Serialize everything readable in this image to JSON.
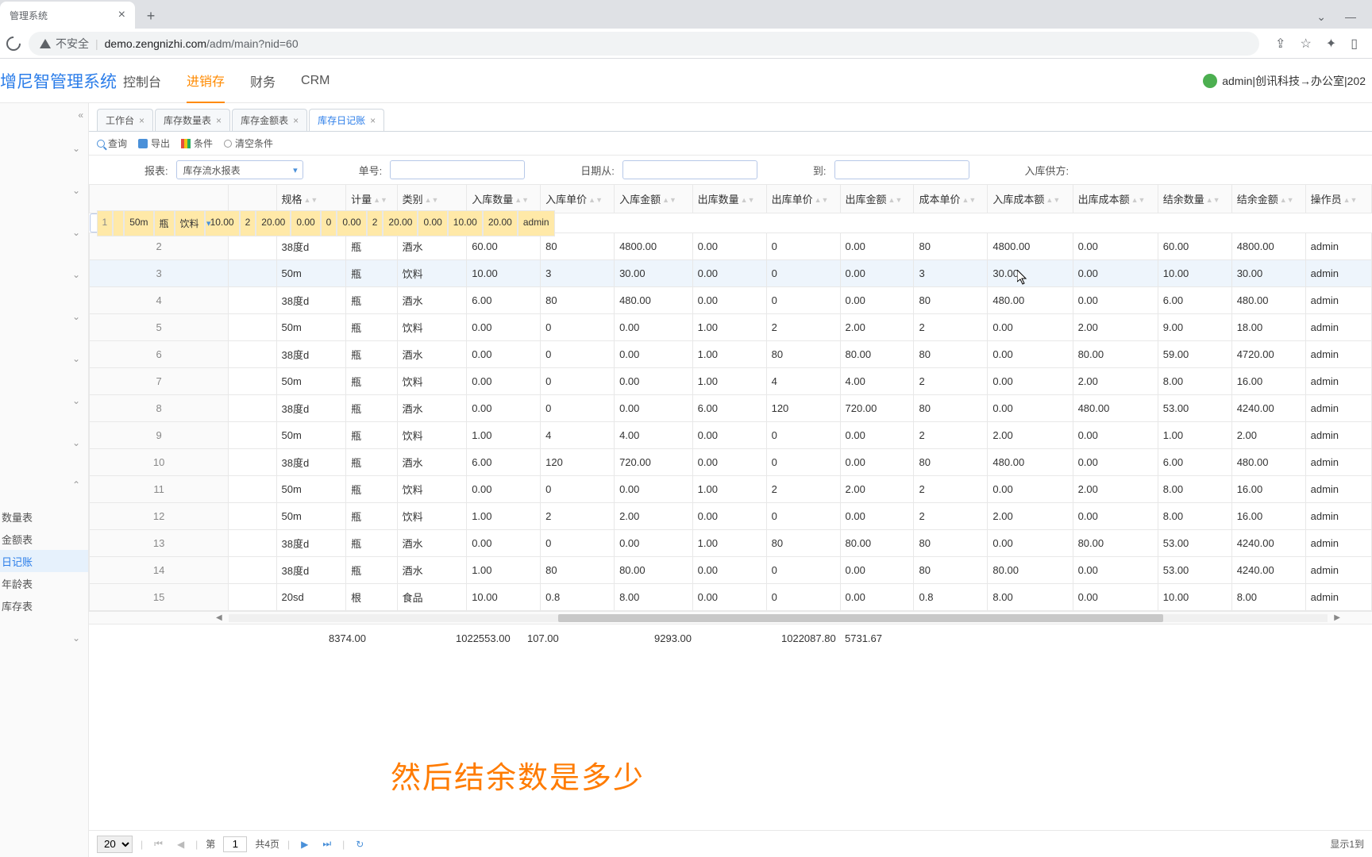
{
  "browser": {
    "tab_title": "管理系统",
    "insecure_label": "不安全",
    "url_host": "demo.zengnizhi.com",
    "url_path": "/adm/main?nid=60"
  },
  "header": {
    "logo": "增尼智管理系统",
    "nav": [
      "控制台",
      "进销存",
      "财务",
      "CRM"
    ],
    "nav_active_index": 1,
    "user": "admin|创讯科技→办公室|202"
  },
  "sidebar": {
    "leaves": [
      "数量表",
      "金额表",
      "日记账",
      "年龄表",
      "库存表"
    ],
    "active_leaf_index": 2
  },
  "tabs": {
    "items": [
      "工作台",
      "库存数量表",
      "库存金额表",
      "库存日记账"
    ],
    "active_index": 3
  },
  "toolbar": {
    "query": "查询",
    "export": "导出",
    "condition": "条件",
    "clear": "清空条件"
  },
  "filters": {
    "report_label": "报表:",
    "report_value": "库存流水报表",
    "bill_label": "单号:",
    "date_from_label": "日期从:",
    "date_to_label": "到:",
    "supplier_label": "入库供方:"
  },
  "columns": [
    "规格",
    "计量",
    "类别",
    "入库数量",
    "入库单价",
    "入库金额",
    "出库数量",
    "出库单价",
    "出库金额",
    "成本单价",
    "入库成本额",
    "出库成本额",
    "结余数量",
    "结余金额",
    "操作员"
  ],
  "rows": [
    {
      "n": 1,
      "sel": true,
      "c": [
        "50m",
        "瓶",
        "饮料",
        "10.00",
        "2",
        "20.00",
        "0.00",
        "0",
        "0.00",
        "2",
        "20.00",
        "0.00",
        "10.00",
        "20.00",
        "admin"
      ]
    },
    {
      "n": 2,
      "c": [
        "38度d",
        "瓶",
        "酒水",
        "60.00",
        "80",
        "4800.00",
        "0.00",
        "0",
        "0.00",
        "80",
        "4800.00",
        "0.00",
        "60.00",
        "4800.00",
        "admin"
      ]
    },
    {
      "n": 3,
      "hov": true,
      "c": [
        "50m",
        "瓶",
        "饮料",
        "10.00",
        "3",
        "30.00",
        "0.00",
        "0",
        "0.00",
        "3",
        "30.00",
        "0.00",
        "10.00",
        "30.00",
        "admin"
      ]
    },
    {
      "n": 4,
      "c": [
        "38度d",
        "瓶",
        "酒水",
        "6.00",
        "80",
        "480.00",
        "0.00",
        "0",
        "0.00",
        "80",
        "480.00",
        "0.00",
        "6.00",
        "480.00",
        "admin"
      ]
    },
    {
      "n": 5,
      "c": [
        "50m",
        "瓶",
        "饮料",
        "0.00",
        "0",
        "0.00",
        "1.00",
        "2",
        "2.00",
        "2",
        "0.00",
        "2.00",
        "9.00",
        "18.00",
        "admin"
      ]
    },
    {
      "n": 6,
      "c": [
        "38度d",
        "瓶",
        "酒水",
        "0.00",
        "0",
        "0.00",
        "1.00",
        "80",
        "80.00",
        "80",
        "0.00",
        "80.00",
        "59.00",
        "4720.00",
        "admin"
      ]
    },
    {
      "n": 7,
      "c": [
        "50m",
        "瓶",
        "饮料",
        "0.00",
        "0",
        "0.00",
        "1.00",
        "4",
        "4.00",
        "2",
        "0.00",
        "2.00",
        "8.00",
        "16.00",
        "admin"
      ]
    },
    {
      "n": 8,
      "c": [
        "38度d",
        "瓶",
        "酒水",
        "0.00",
        "0",
        "0.00",
        "6.00",
        "120",
        "720.00",
        "80",
        "0.00",
        "480.00",
        "53.00",
        "4240.00",
        "admin"
      ]
    },
    {
      "n": 9,
      "c": [
        "50m",
        "瓶",
        "饮料",
        "1.00",
        "4",
        "4.00",
        "0.00",
        "0",
        "0.00",
        "2",
        "2.00",
        "0.00",
        "1.00",
        "2.00",
        "admin"
      ]
    },
    {
      "n": 10,
      "c": [
        "38度d",
        "瓶",
        "酒水",
        "6.00",
        "120",
        "720.00",
        "0.00",
        "0",
        "0.00",
        "80",
        "480.00",
        "0.00",
        "6.00",
        "480.00",
        "admin"
      ]
    },
    {
      "n": 11,
      "c": [
        "50m",
        "瓶",
        "饮料",
        "0.00",
        "0",
        "0.00",
        "1.00",
        "2",
        "2.00",
        "2",
        "0.00",
        "2.00",
        "8.00",
        "16.00",
        "admin"
      ]
    },
    {
      "n": 12,
      "c": [
        "50m",
        "瓶",
        "饮料",
        "1.00",
        "2",
        "2.00",
        "0.00",
        "0",
        "0.00",
        "2",
        "2.00",
        "0.00",
        "8.00",
        "16.00",
        "admin"
      ]
    },
    {
      "n": 13,
      "c": [
        "38度d",
        "瓶",
        "酒水",
        "0.00",
        "0",
        "0.00",
        "1.00",
        "80",
        "80.00",
        "80",
        "0.00",
        "80.00",
        "53.00",
        "4240.00",
        "admin"
      ]
    },
    {
      "n": 14,
      "c": [
        "38度d",
        "瓶",
        "酒水",
        "1.00",
        "80",
        "80.00",
        "0.00",
        "0",
        "0.00",
        "80",
        "80.00",
        "0.00",
        "53.00",
        "4240.00",
        "admin"
      ]
    },
    {
      "n": 15,
      "c": [
        "20sd",
        "根",
        "食品",
        "10.00",
        "0.8",
        "8.00",
        "0.00",
        "0",
        "0.00",
        "0.8",
        "8.00",
        "0.00",
        "10.00",
        "8.00",
        "admin"
      ]
    }
  ],
  "totals": {
    "in_qty": "8374.00",
    "in_amt": "1022553.00",
    "out_qty": "107.00",
    "out_amt": "9293.00",
    "in_cost": "1022087.80",
    "out_cost": "5731.67"
  },
  "pager": {
    "page_size": "20",
    "page_label_prefix": "第",
    "page": "1",
    "total_pages_label": "共4页",
    "display_label": "显示1到"
  },
  "caption": "然后结余数是多少"
}
